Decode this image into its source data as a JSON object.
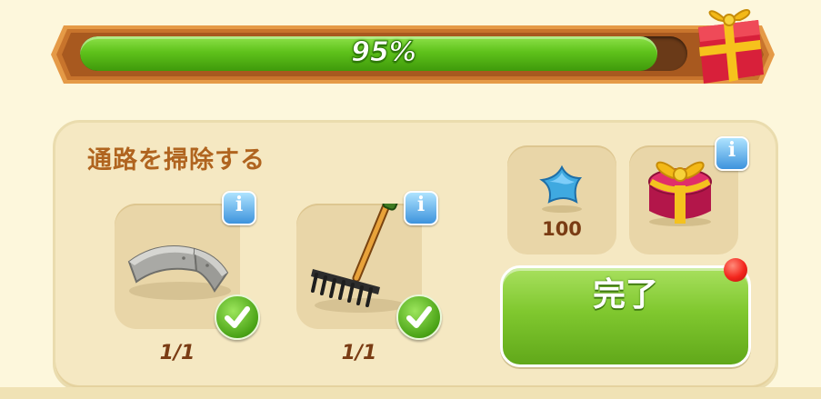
{
  "progress": {
    "percent": 0.95,
    "label": "95%"
  },
  "task": {
    "title": "通路を掃除する",
    "items": [
      {
        "name": "stone-path",
        "count": "1/1",
        "info": "i",
        "completed": true
      },
      {
        "name": "rake",
        "count": "1/1",
        "info": "i",
        "completed": true
      }
    ]
  },
  "rewards": {
    "star": {
      "amount": "100",
      "icon": "blue-star-icon"
    },
    "gift": {
      "info": "i",
      "icon": "gift-box-icon"
    }
  },
  "complete_button": {
    "label": "完了"
  },
  "colors": {
    "accent_green": "#6cc123",
    "frame_brown": "#c8742c",
    "title_brown": "#b0641f",
    "info_blue": "#3d93dd",
    "notify_red": "#f3261d"
  }
}
